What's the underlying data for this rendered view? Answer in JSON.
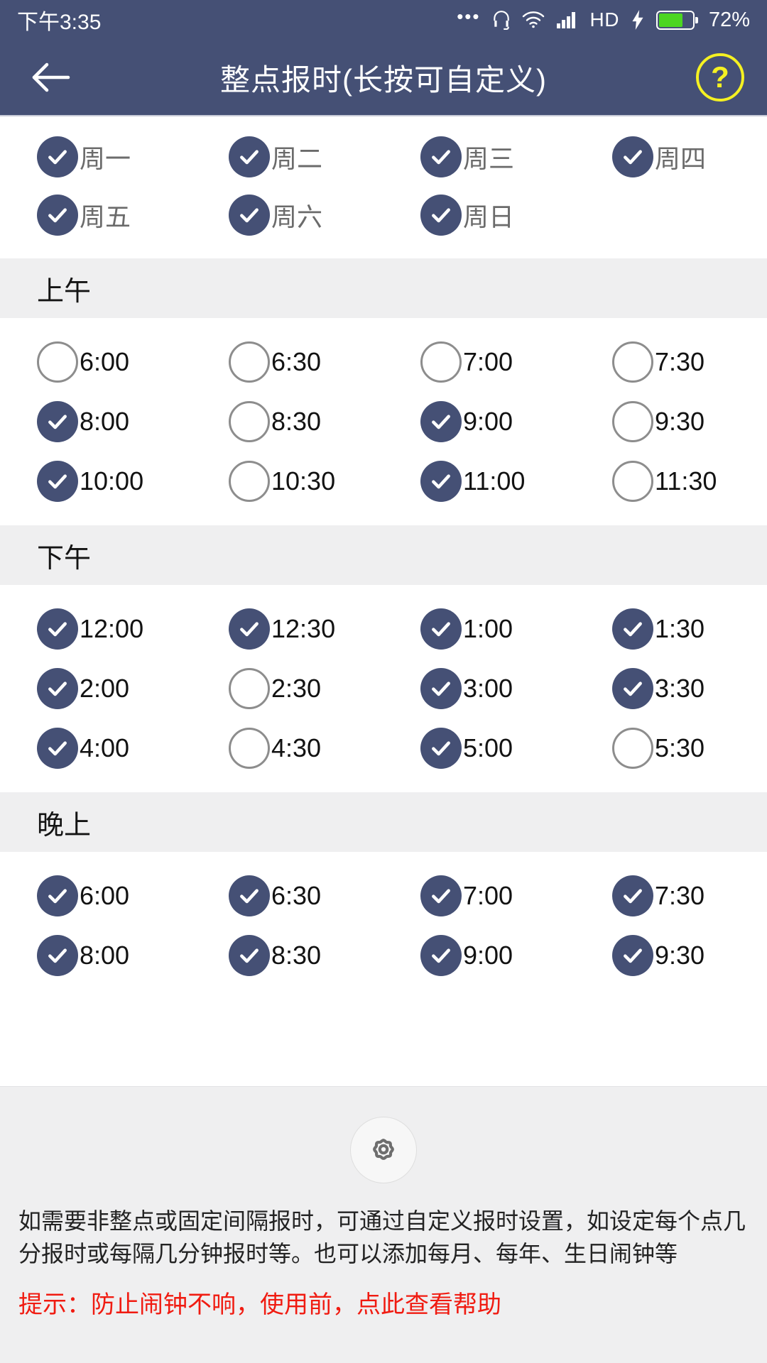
{
  "status_bar": {
    "time": "下午3:35",
    "battery_percent": "72%",
    "battery_level": 72,
    "hd_label": "HD",
    "icons": [
      "dots-icon",
      "headset-icon",
      "wifi-icon",
      "signal-icon",
      "hd-icon",
      "charging-bolt-icon",
      "battery-icon"
    ]
  },
  "header": {
    "title": "整点报时(长按可自定义)",
    "back_icon": "back-arrow-icon",
    "help_label": "?",
    "accent_color": "#455075",
    "help_color": "#f5f122"
  },
  "weekdays": [
    {
      "label": "周一",
      "checked": true
    },
    {
      "label": "周二",
      "checked": true
    },
    {
      "label": "周三",
      "checked": true
    },
    {
      "label": "周四",
      "checked": true
    },
    {
      "label": "周五",
      "checked": true
    },
    {
      "label": "周六",
      "checked": true
    },
    {
      "label": "周日",
      "checked": true
    }
  ],
  "sections": [
    {
      "title": "上午",
      "times": [
        {
          "label": "6:00",
          "checked": false
        },
        {
          "label": "6:30",
          "checked": false
        },
        {
          "label": "7:00",
          "checked": false
        },
        {
          "label": "7:30",
          "checked": false
        },
        {
          "label": "8:00",
          "checked": true
        },
        {
          "label": "8:30",
          "checked": false
        },
        {
          "label": "9:00",
          "checked": true
        },
        {
          "label": "9:30",
          "checked": false
        },
        {
          "label": "10:00",
          "checked": true
        },
        {
          "label": "10:30",
          "checked": false
        },
        {
          "label": "11:00",
          "checked": true
        },
        {
          "label": "11:30",
          "checked": false
        }
      ]
    },
    {
      "title": "下午",
      "times": [
        {
          "label": "12:00",
          "checked": true
        },
        {
          "label": "12:30",
          "checked": true
        },
        {
          "label": "1:00",
          "checked": true
        },
        {
          "label": "1:30",
          "checked": true
        },
        {
          "label": "2:00",
          "checked": true
        },
        {
          "label": "2:30",
          "checked": false
        },
        {
          "label": "3:00",
          "checked": true
        },
        {
          "label": "3:30",
          "checked": true
        },
        {
          "label": "4:00",
          "checked": true
        },
        {
          "label": "4:30",
          "checked": false
        },
        {
          "label": "5:00",
          "checked": true
        },
        {
          "label": "5:30",
          "checked": false
        }
      ]
    },
    {
      "title": "晚上",
      "times": [
        {
          "label": "6:00",
          "checked": true
        },
        {
          "label": "6:30",
          "checked": true
        },
        {
          "label": "7:00",
          "checked": true
        },
        {
          "label": "7:30",
          "checked": true
        },
        {
          "label": "8:00",
          "checked": true
        },
        {
          "label": "8:30",
          "checked": true
        },
        {
          "label": "9:00",
          "checked": true
        },
        {
          "label": "9:30",
          "checked": true
        }
      ]
    }
  ],
  "footer": {
    "settings_icon": "gear-icon",
    "description": "如需要非整点或固定间隔报时，可通过自定义报时设置，如设定每个点几分报时或每隔几分钟报时等。也可以添加每月、每年、生日闹钟等",
    "hint": "提示：防止闹钟不响，使用前，点此查看帮助",
    "hint_color": "#f01b11"
  }
}
